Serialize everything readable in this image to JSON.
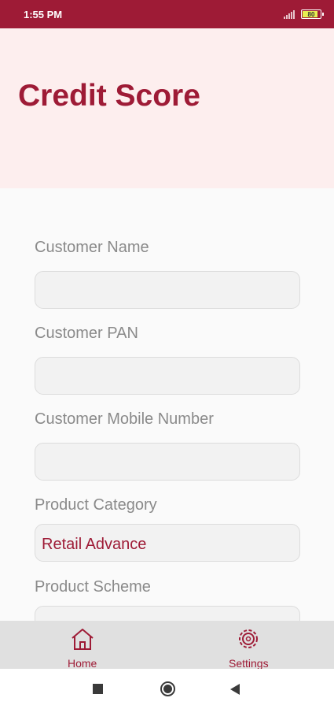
{
  "status_bar": {
    "time": "1:55 PM",
    "battery_level": "80",
    "icons": [
      "signal-icon",
      "battery-icon"
    ]
  },
  "header": {
    "title": "Credit Score"
  },
  "form": {
    "fields": [
      {
        "label": "Customer Name",
        "value": ""
      },
      {
        "label": "Customer PAN",
        "value": ""
      },
      {
        "label": "Customer Mobile Number",
        "value": ""
      },
      {
        "label": "Product Category",
        "value": "Retail Advance"
      },
      {
        "label": "Product Scheme",
        "value": ""
      }
    ]
  },
  "bottom_nav": {
    "items": [
      {
        "label": "Home",
        "icon": "home-icon"
      },
      {
        "label": "Settings",
        "icon": "settings-icon"
      }
    ]
  },
  "system_nav": {
    "icons": [
      "recents-icon",
      "home-circle-icon",
      "back-icon"
    ]
  },
  "colors": {
    "primary": "#9e1b36",
    "header_bg": "#fdeeee",
    "field_bg": "#f2f2f2",
    "label": "#8a8a8a"
  }
}
